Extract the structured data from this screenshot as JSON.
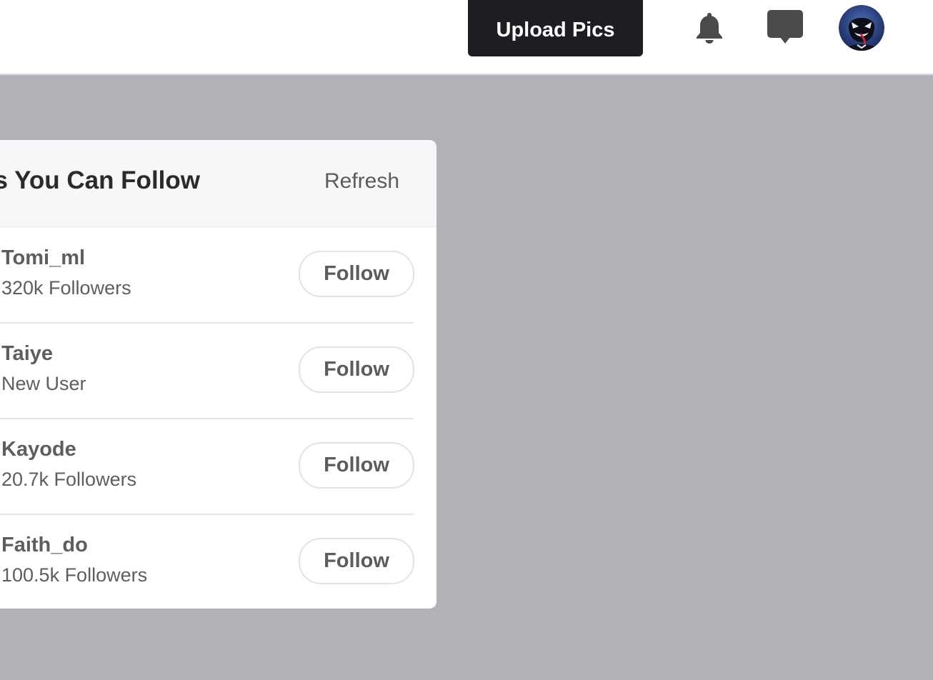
{
  "topbar": {
    "upload_label": "Upload Pics",
    "icons": [
      "bell-icon",
      "chat-icon",
      "avatar"
    ]
  },
  "suggestions": {
    "title": "s You Can Follow",
    "refresh_label": "Refresh",
    "users": [
      {
        "name": "Tomi_ml",
        "followers": "320k Followers",
        "action": "Follow"
      },
      {
        "name": "Taiye",
        "followers": "New User",
        "action": "Follow"
      },
      {
        "name": "Kayode",
        "followers": "20.7k Followers",
        "action": "Follow"
      },
      {
        "name": "Faith_do",
        "followers": "100.5k Followers",
        "action": "Follow"
      }
    ]
  },
  "colors": {
    "backdrop": "#b0b2b7",
    "button_dark": "#1d1e22",
    "icon": "#4a4a4a"
  }
}
